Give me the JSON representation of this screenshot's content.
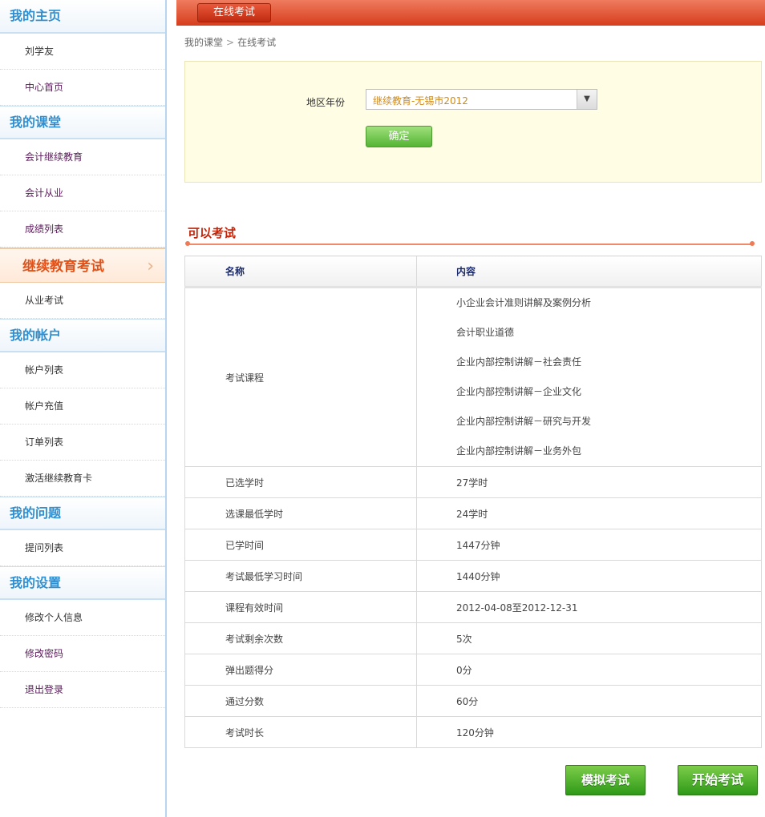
{
  "sidebar": {
    "sections": [
      {
        "title": "我的主页",
        "items": [
          {
            "label": "刘学友"
          },
          {
            "label": "中心首页"
          }
        ]
      },
      {
        "title": "我的课堂",
        "items": [
          {
            "label": "会计继续教育"
          },
          {
            "label": "会计从业"
          },
          {
            "label": "成绩列表"
          },
          {
            "label": "继续教育考试"
          },
          {
            "label": "从业考试"
          }
        ]
      },
      {
        "title": "我的帐户",
        "items": [
          {
            "label": "帐户列表"
          },
          {
            "label": "帐户充值"
          },
          {
            "label": "订单列表"
          },
          {
            "label": "激活继续教育卡"
          }
        ]
      },
      {
        "title": "我的问题",
        "items": [
          {
            "label": "提问列表"
          }
        ]
      },
      {
        "title": "我的设置",
        "items": [
          {
            "label": "修改个人信息"
          },
          {
            "label": "修改密码"
          },
          {
            "label": "退出登录"
          }
        ]
      }
    ]
  },
  "header": {
    "tab_label": "在线考试"
  },
  "breadcrumb": {
    "parent": "我的课堂",
    "separator": ">",
    "current": "在线考试"
  },
  "filter": {
    "region_label": "地区年份",
    "region_value": "继续教育-无锡市2012",
    "confirm_label": "确定"
  },
  "section": {
    "title": "可以考试"
  },
  "table": {
    "col_name": "名称",
    "col_content": "内容",
    "courses_label": "考试课程",
    "courses": [
      "小企业会计准则讲解及案例分析",
      "会计职业道德",
      "企业内部控制讲解－社会责任",
      "企业内部控制讲解－企业文化",
      "企业内部控制讲解－研究与开发",
      "企业内部控制讲解－业务外包"
    ],
    "rows": [
      {
        "name": "已选学时",
        "value": "27学时"
      },
      {
        "name": "选课最低学时",
        "value": "24学时"
      },
      {
        "name": "已学时间",
        "value": "1447分钟"
      },
      {
        "name": "考试最低学习时间",
        "value": "1440分钟"
      },
      {
        "name": "课程有效时间",
        "value": "2012-04-08至2012-12-31"
      },
      {
        "name": "考试剩余次数",
        "value": "5次"
      },
      {
        "name": "弹出题得分",
        "value": "0分"
      },
      {
        "name": "通过分数",
        "value": "60分"
      },
      {
        "name": "考试时长",
        "value": "120分钟"
      }
    ]
  },
  "actions": {
    "mock_label": "模拟考试",
    "start_label": "开始考试"
  },
  "colors": {
    "accent_red": "#d63d1d",
    "sidebar_blue": "#2f8fd0",
    "active_orange": "#e0531a",
    "button_green": "#2f9a18"
  }
}
